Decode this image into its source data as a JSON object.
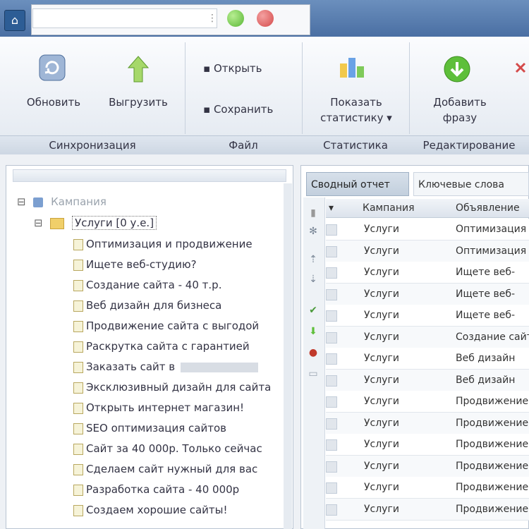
{
  "title": {
    "search_value": ""
  },
  "colors": {
    "accent_blue": "#4a6fa3",
    "green": "#58b634",
    "red": "#d44a4a"
  },
  "ribbon": {
    "refresh": "Обновить",
    "upload": "Выгрузить",
    "open": "Открыть",
    "save": "Сохранить",
    "stats_line1": "Показать",
    "stats_line2": "статистику",
    "add_line1": "Добавить",
    "add_line2": "фразу"
  },
  "groups": [
    "Синхронизация",
    "Файл",
    "Статистика",
    "Редактирование"
  ],
  "tree": {
    "root": "Кампания",
    "folder": "Услуги [0 у.е.]",
    "items": [
      "Оптимизация и продвижение",
      "Ищете веб-студию?",
      "Создание сайта - 40 т.р.",
      "Веб дизайн для бизнеса",
      "Продвижение сайта с выгодой",
      "Раскрутка сайта с гарантией",
      "Заказать сайт в",
      "Эксклюзивный дизайн для сайта",
      "Открыть интернет магазин!",
      "SEO оптимизация сайтов",
      "Сайт за 40 000р. Только сейчас",
      "Сделаем сайт нужный для вас",
      "Разработка сайта - 40 000р",
      "Создаем хорошие сайты!"
    ]
  },
  "tabs": {
    "summary": "Сводный отчет",
    "keywords": "Ключевые слова"
  },
  "grid": {
    "columns": [
      "Кампания",
      "Объявление"
    ],
    "rows": [
      [
        "Услуги",
        "Оптимизация"
      ],
      [
        "Услуги",
        "Оптимизация"
      ],
      [
        "Услуги",
        "Ищете веб-"
      ],
      [
        "Услуги",
        "Ищете веб-"
      ],
      [
        "Услуги",
        "Ищете веб-"
      ],
      [
        "Услуги",
        "Создание сайта"
      ],
      [
        "Услуги",
        "Веб дизайн"
      ],
      [
        "Услуги",
        "Веб дизайн"
      ],
      [
        "Услуги",
        "Продвижение"
      ],
      [
        "Услуги",
        "Продвижение"
      ],
      [
        "Услуги",
        "Продвижение"
      ],
      [
        "Услуги",
        "Продвижение"
      ],
      [
        "Услуги",
        "Продвижение"
      ],
      [
        "Услуги",
        "Продвижение"
      ]
    ]
  }
}
